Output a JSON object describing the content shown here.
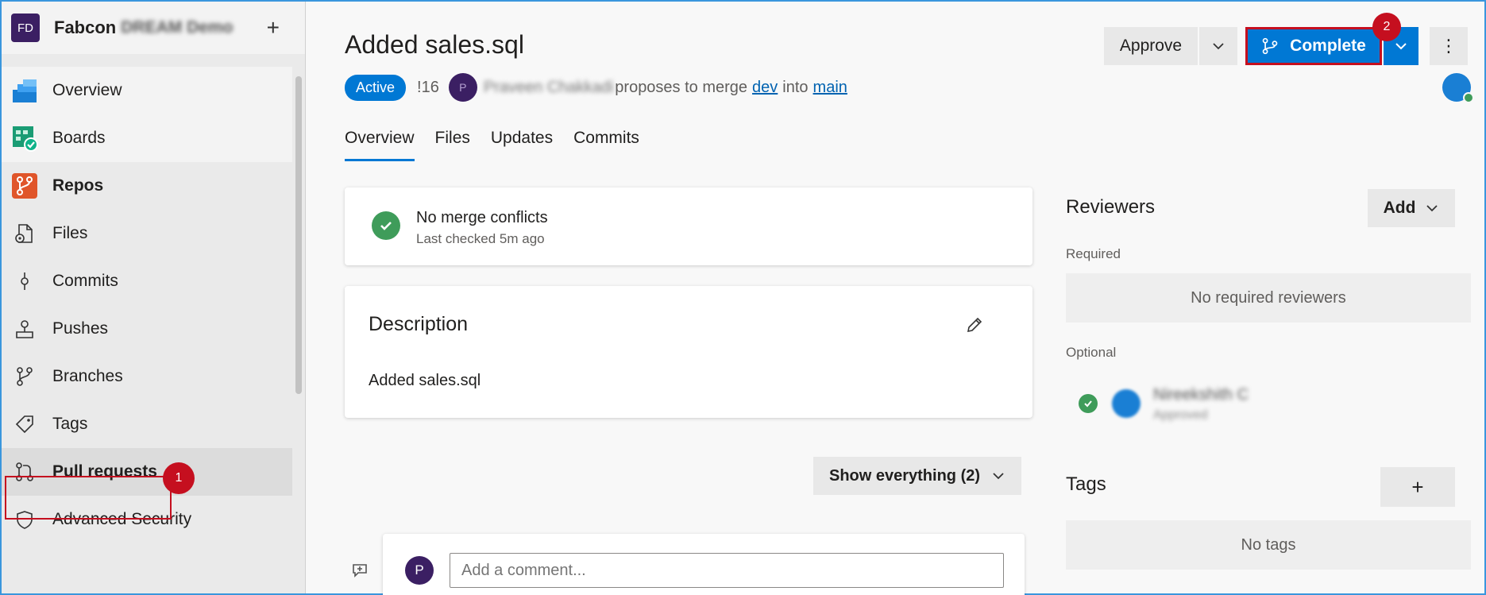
{
  "project": {
    "initials": "FD",
    "name": "Fabcon",
    "name_blurred": "DREAM Demo",
    "add_label": "+"
  },
  "nav": [
    {
      "label": "Overview"
    },
    {
      "label": "Boards"
    },
    {
      "label": "Repos"
    },
    {
      "label": "Files"
    },
    {
      "label": "Commits"
    },
    {
      "label": "Pushes"
    },
    {
      "label": "Branches"
    },
    {
      "label": "Tags"
    },
    {
      "label": "Pull requests"
    },
    {
      "label": "Advanced Security"
    }
  ],
  "callouts": {
    "one": "1",
    "two": "2"
  },
  "pr": {
    "title": "Added sales.sql",
    "status": "Active",
    "id": "!16",
    "author_initial": "P",
    "author_blurred": "Praveen Chakkadi",
    "proposes_text": "proposes to merge",
    "source_branch": "dev",
    "into_text": "into",
    "target_branch": "main"
  },
  "actions": {
    "approve": "Approve",
    "complete": "Complete",
    "more": "⋮"
  },
  "tabs": [
    "Overview",
    "Files",
    "Updates",
    "Commits"
  ],
  "merge": {
    "status": "No merge conflicts",
    "checked": "Last checked 5m ago"
  },
  "description": {
    "heading": "Description",
    "body": "Added sales.sql"
  },
  "filter": {
    "label": "Show everything (2)"
  },
  "comment": {
    "avatar": "P",
    "placeholder": "Add a comment..."
  },
  "reviewers": {
    "heading": "Reviewers",
    "add": "Add",
    "required_label": "Required",
    "required_empty": "No required reviewers",
    "optional_label": "Optional",
    "optional_name_blurred": "Nireekshith C",
    "optional_status_blurred": "Approved"
  },
  "tags": {
    "heading": "Tags",
    "add": "+",
    "empty": "No tags"
  },
  "colors": {
    "accent": "#0078d4",
    "callout": "#c50f1f",
    "success": "#3f9c5a"
  }
}
